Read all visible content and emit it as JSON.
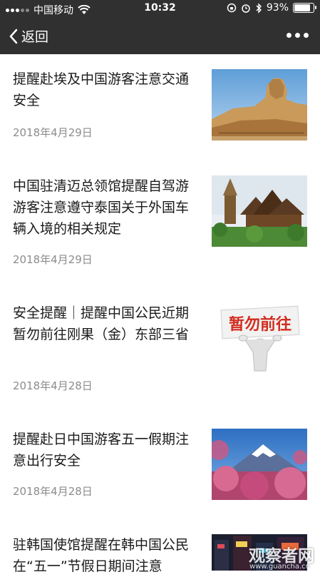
{
  "status_bar": {
    "carrier": "中国移动",
    "time": "10:32",
    "battery": "93%",
    "battery_level": 0.93
  },
  "nav": {
    "back_label": "返回"
  },
  "articles": [
    {
      "title": "提醒赴埃及中国游客注意交通安全",
      "date": "2018年4月29日",
      "image": "sphinx"
    },
    {
      "title": "中国驻清迈总领馆提醒自驾游游客注意遵守泰国关于外国车辆入境的相关规定",
      "date": "2018年4月29日",
      "image": "thai-temple"
    },
    {
      "title": "安全提醒｜提醒中国公民近期暂勿前往刚果（金）东部三省",
      "date": "2018年4月28日",
      "image": "warning-sign",
      "image_text": "暂勿前往"
    },
    {
      "title": "提醒赴日中国游客五一假期注意出行安全",
      "date": "2018年4月28日",
      "image": "mount-fuji"
    },
    {
      "title": "驻韩国使馆提醒在韩中国公民在“五一”节假日期间注意",
      "date": "",
      "image": "city-night"
    }
  ],
  "watermark": {
    "text": "观察者网",
    "url": "www.guancha.cn"
  }
}
